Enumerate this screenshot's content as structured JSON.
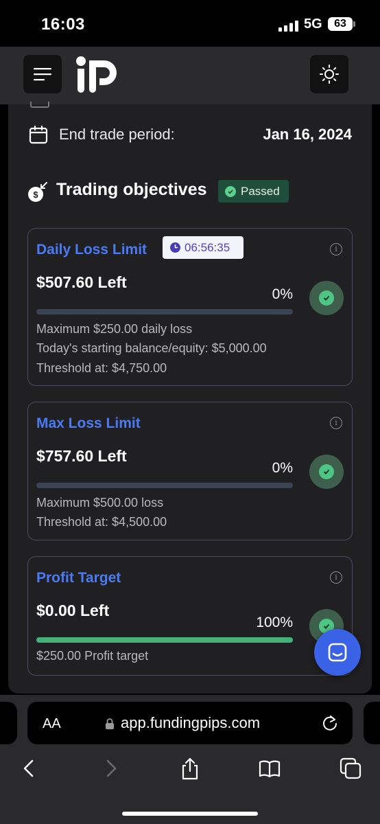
{
  "status_bar": {
    "time": "16:03",
    "network": "5G",
    "battery": "63"
  },
  "end_trade": {
    "label": "End trade period:",
    "value": "Jan 16, 2024"
  },
  "objectives": {
    "title": "Trading objectives",
    "badge": "Passed"
  },
  "cards": [
    {
      "title": "Daily Loss Limit",
      "timer": "06:56:35",
      "amount_left": "$507.60 Left",
      "percent": "0%",
      "progress": 0,
      "lines": [
        "Maximum $250.00 daily loss",
        "Today's starting balance/equity: $5,000.00",
        "Threshold at: $4,750.00"
      ]
    },
    {
      "title": "Max Loss Limit",
      "amount_left": "$757.60 Left",
      "percent": "0%",
      "progress": 0,
      "lines": [
        "Maximum $500.00 loss",
        "Threshold at: $4,500.00"
      ]
    },
    {
      "title": "Profit Target",
      "amount_left": "$0.00 Left",
      "percent": "100%",
      "progress": 1,
      "lines": [
        "$250.00 Profit target"
      ]
    }
  ],
  "browser": {
    "text_size_label": "AA",
    "url": "app.fundingpips.com"
  },
  "colors": {
    "accent_blue": "#4a7bf3",
    "success_green": "#46b07a",
    "chat_blue": "#3a62e6"
  }
}
